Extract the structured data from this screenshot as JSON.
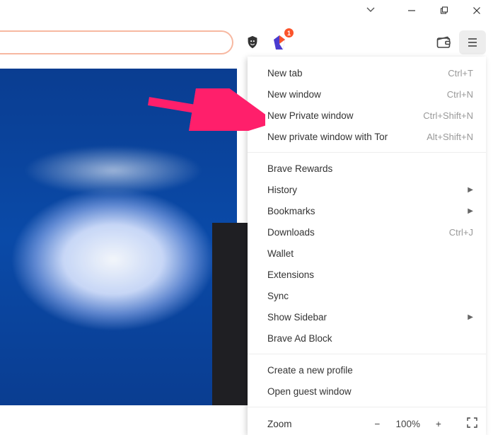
{
  "window_controls": {
    "minimize_tooltip": "Minimize",
    "maximize_tooltip": "Restore",
    "close_tooltip": "Close"
  },
  "toolbar": {
    "shield_tooltip": "Brave Shields",
    "rewards_badge": "1",
    "wallet_tooltip": "Brave Wallet",
    "menu_tooltip": "Customize and control Brave"
  },
  "menu": {
    "items_a": [
      {
        "label": "New tab",
        "shortcut": "Ctrl+T"
      },
      {
        "label": "New window",
        "shortcut": "Ctrl+N"
      },
      {
        "label": "New Private window",
        "shortcut": "Ctrl+Shift+N"
      },
      {
        "label": "New private window with Tor",
        "shortcut": "Alt+Shift+N"
      }
    ],
    "items_b": [
      {
        "label": "Brave Rewards"
      },
      {
        "label": "History",
        "submenu": true
      },
      {
        "label": "Bookmarks",
        "submenu": true
      },
      {
        "label": "Downloads",
        "shortcut": "Ctrl+J"
      },
      {
        "label": "Wallet"
      },
      {
        "label": "Extensions"
      },
      {
        "label": "Sync"
      },
      {
        "label": "Show Sidebar",
        "submenu": true
      },
      {
        "label": "Brave Ad Block"
      }
    ],
    "items_c": [
      {
        "label": "Create a new profile"
      },
      {
        "label": "Open guest window"
      }
    ],
    "zoom": {
      "label": "Zoom",
      "minus": "−",
      "value": "100%",
      "plus": "+"
    }
  },
  "annotation": {
    "target": "New Private window"
  }
}
